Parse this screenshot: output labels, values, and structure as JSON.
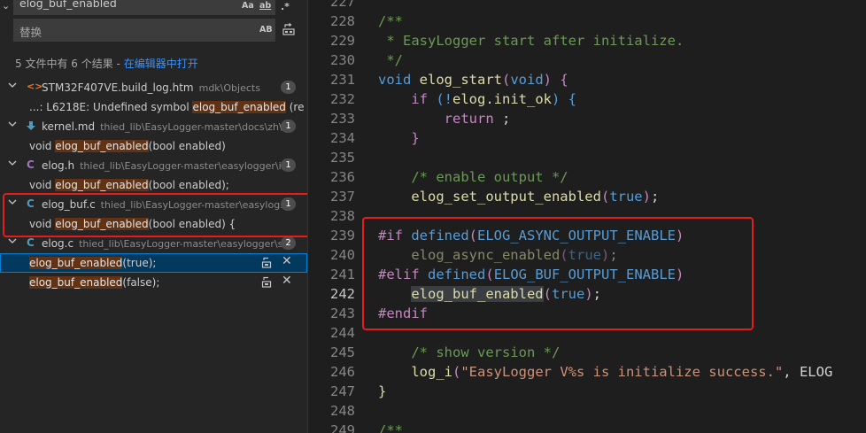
{
  "search": {
    "find_value": "elog_buf_enabled",
    "replace_placeholder": "替换",
    "opt_case": "Aa",
    "opt_word": "ab",
    "opt_regex": ".*",
    "opt_preserve_case": "AB"
  },
  "summary": {
    "text": "5 文件中有 6 个结果 - ",
    "open_in_editor": "在编辑器中打开"
  },
  "results": [
    {
      "file": "STM32F407VE.build_log.htm",
      "path": "mdk\\Objects",
      "count": "1",
      "matches": [
        {
          "pre": "...: L6218E: Undefined symbol ",
          "hit": "elog_buf_enabled",
          "post": " (refe..."
        }
      ]
    },
    {
      "file": "kernel.md",
      "path": "thied_lib\\EasyLogger-master\\docs\\zh\\...",
      "count": "1",
      "matches": [
        {
          "pre": "void ",
          "hit": "elog_buf_enabled",
          "post": "(bool enabled)"
        }
      ]
    },
    {
      "file": "elog.h",
      "path": "thied_lib\\EasyLogger-master\\easylogger\\inc",
      "count": "1",
      "matches": [
        {
          "pre": "void ",
          "hit": "elog_buf_enabled",
          "post": "(bool enabled);"
        }
      ]
    },
    {
      "file": "elog_buf.c",
      "path": "thied_lib\\EasyLogger-master\\easylog...",
      "count": "1",
      "matches": [
        {
          "pre": "void ",
          "hit": "elog_buf_enabled",
          "post": "(bool enabled) {"
        }
      ]
    },
    {
      "file": "elog.c",
      "path": "thied_lib\\EasyLogger-master\\easylogger\\src",
      "count": "2",
      "matches": [
        {
          "pre": "",
          "hit": "elog_buf_enabled",
          "post": "(true);"
        },
        {
          "pre": "",
          "hit": "elog_buf_enabled",
          "post": "(false);"
        }
      ]
    }
  ],
  "editor": {
    "line_numbers": [
      "227",
      "228",
      "229",
      "230",
      "231",
      "232",
      "233",
      "234",
      "235",
      "236",
      "237",
      "238",
      "239",
      "240",
      "241",
      "242",
      "243",
      "244",
      "245",
      "246",
      "247",
      "248",
      "249"
    ],
    "current_line": "242",
    "code_tokens": {
      "l228": "/**",
      "l229": " * EasyLogger start after initialize.",
      "l230": " */",
      "l231_void": "void",
      "l231_fn": "elog_start",
      "l231_open": "(",
      "l231_param": "void",
      "l231_close": ") {",
      "l232_if": "if",
      "l232_rest": " (!",
      "l232_elog": "elog",
      "l232_dot": ".",
      "l232_init": "init_ok",
      "l232_end": ") {",
      "l233_ret": "return",
      "l233_semi": " ;",
      "l234": "}",
      "l236": "/* enable output */",
      "l237_fn": "elog_set_output_enabled",
      "l237_arg": "true",
      "l239_if": "#if",
      "l239_def": "defined",
      "l239_mac": "ELOG_ASYNC_OUTPUT_ENABLE",
      "l240_fn": "elog_async_enabled",
      "l240_arg": "true",
      "l241_elif": "#elif",
      "l241_def": "defined",
      "l241_mac": "ELOG_BUF_OUTPUT_ENABLE",
      "l242_fn": "elog_buf_enabled",
      "l242_arg": "true",
      "l243_endif": "#endif",
      "l245": "/* show version */",
      "l246_fn": "log_i",
      "l246_str": "\"EasyLogger V%s is initialize success.\"",
      "l246_arg": ", ELOG",
      "l247": "}",
      "l249": "/**"
    }
  },
  "colors": {
    "annotation_red": "#e51c1c",
    "match_highlight": "#613214",
    "selection_blue": "#04395e",
    "link_blue": "#3794ff"
  }
}
